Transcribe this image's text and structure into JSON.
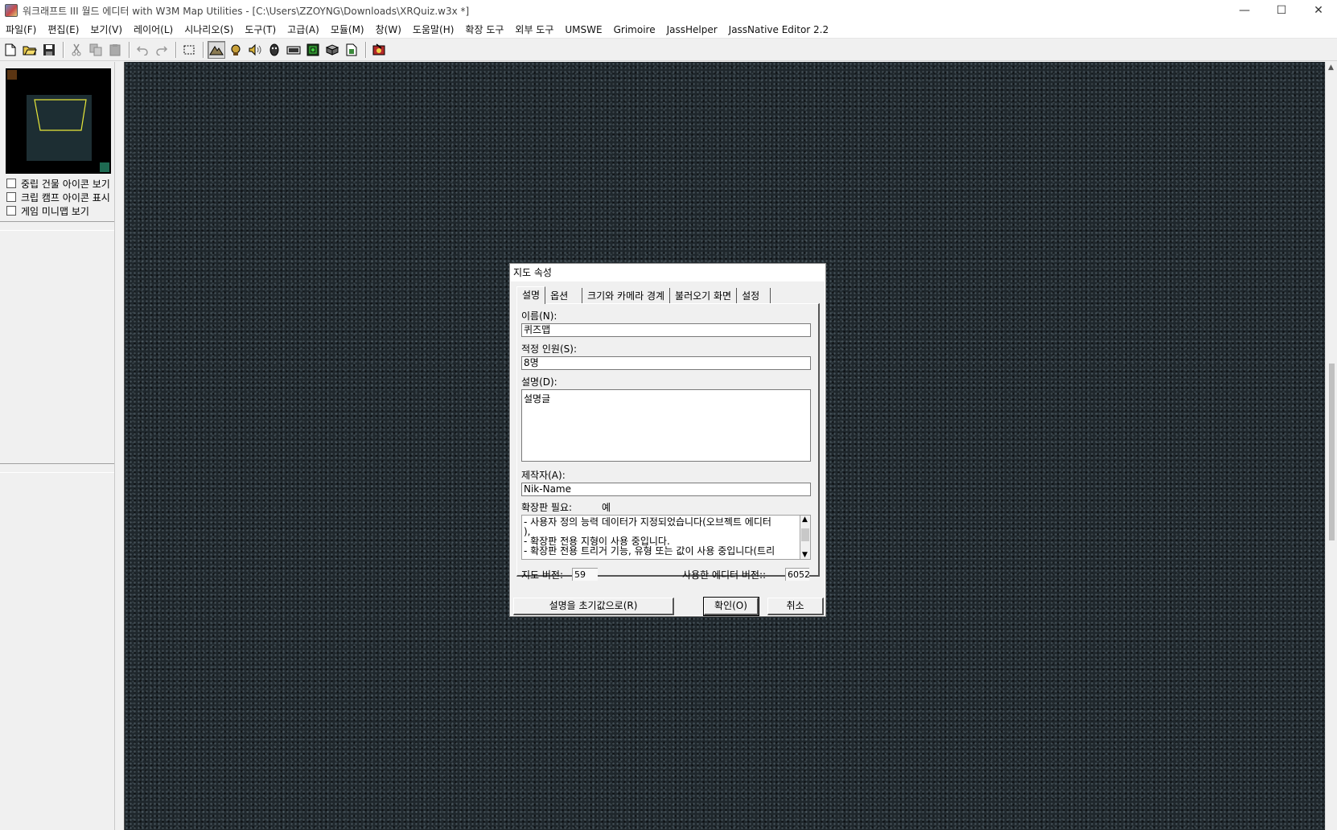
{
  "window": {
    "title": "워크래프트 III 월드 에디터 with W3M Map Utilities - [C:\\Users\\ZZOYNG\\Downloads\\XRQuiz.w3x *]",
    "minimize": "—",
    "maximize": "☐",
    "close": "✕"
  },
  "menu": [
    "파일(F)",
    "편집(E)",
    "보기(V)",
    "레이어(L)",
    "시나리오(S)",
    "도구(T)",
    "고급(A)",
    "모듈(M)",
    "창(W)",
    "도움말(H)",
    "확장 도구",
    "외부 도구",
    "UMSWE",
    "Grimoire",
    "JassHelper",
    "JassNative Editor 2.2"
  ],
  "left_panel": {
    "checkboxes": [
      "중립 건물 아이콘 보기",
      "크립 캠프 아이콘 표시",
      "게임 미니맵 보기"
    ]
  },
  "dialog": {
    "title": "지도 속성",
    "tabs": [
      "설명",
      "옵션",
      "크기와 카메라 경계",
      "불러오기 화면",
      "설정"
    ],
    "name_label": "이름(N):",
    "name_value": "퀴즈맵",
    "players_label": "적정 인원(S):",
    "players_value": "8명",
    "desc_label": "설명(D):",
    "desc_value": "설명글",
    "author_label": "제작자(A):",
    "author_value": "Nik-Name",
    "expansion_label": "확장판 필요:",
    "expansion_value": "예",
    "requirements": [
      "- 사용자 정의 능력 데이터가 지정되었습니다(오브젝트 에디터",
      "),",
      "- 확장판 전용 지형이 사용 중입니다.",
      "- 확장판 전용 트리거 기능, 유형 또는 값이 사용 중입니다(트리"
    ],
    "map_version_label": "지도 버전:",
    "map_version_value": "59",
    "editor_version_label": "사용한 에디터 버전::",
    "editor_version_value": "6052",
    "reset_button": "설명을 초기값으로(R)",
    "ok_button": "확인(O)",
    "cancel_button": "취소"
  }
}
